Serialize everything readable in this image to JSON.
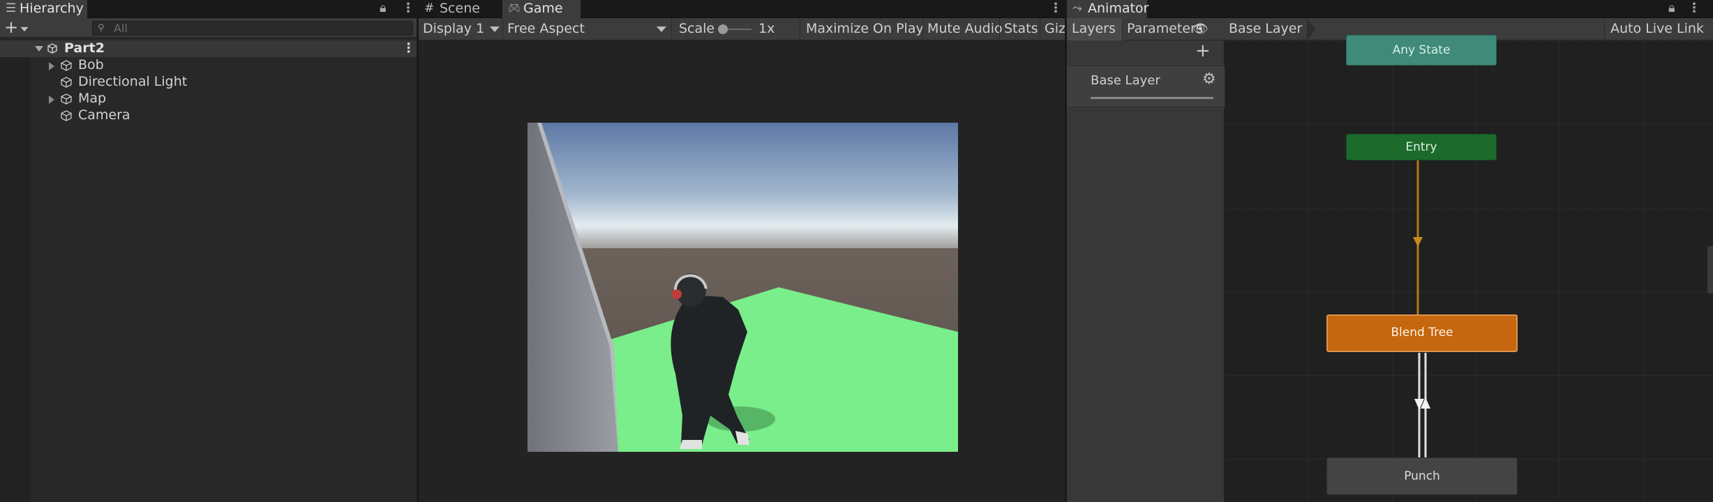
{
  "hierarchy": {
    "tab_label": "Hierarchy",
    "search_placeholder": "All",
    "scene_name": "Part2",
    "items": [
      {
        "label": "Bob"
      },
      {
        "label": "Directional Light"
      },
      {
        "label": "Map"
      },
      {
        "label": "Camera"
      }
    ]
  },
  "game": {
    "tabs": [
      {
        "label": "Scene"
      },
      {
        "label": "Game"
      }
    ],
    "display": "Display 1",
    "aspect": "Free Aspect",
    "scale_label": "Scale",
    "scale_value": 0.0,
    "scale_text": "1x",
    "maximize_label": "Maximize On Play",
    "mute_label": "Mute Audio",
    "stats_label": "Stats",
    "gizmos_label": "Giz"
  },
  "animator": {
    "tab_label": "Animator",
    "layers_tab": "Layers",
    "parameters_tab": "Parameters",
    "breadcrumb": "Base Layer",
    "auto_live_link": "Auto Live Link",
    "layer_name": "Base Layer",
    "states": {
      "any_state": "Any State",
      "entry": "Entry",
      "blend_tree": "Blend Tree",
      "punch": "Punch"
    }
  },
  "colors": {
    "any_state": "#3f8a78",
    "entry": "#1c6b2c",
    "blend_tree": "#c4670e",
    "punch": "#444444",
    "transition_entry": "#b07a1a"
  }
}
